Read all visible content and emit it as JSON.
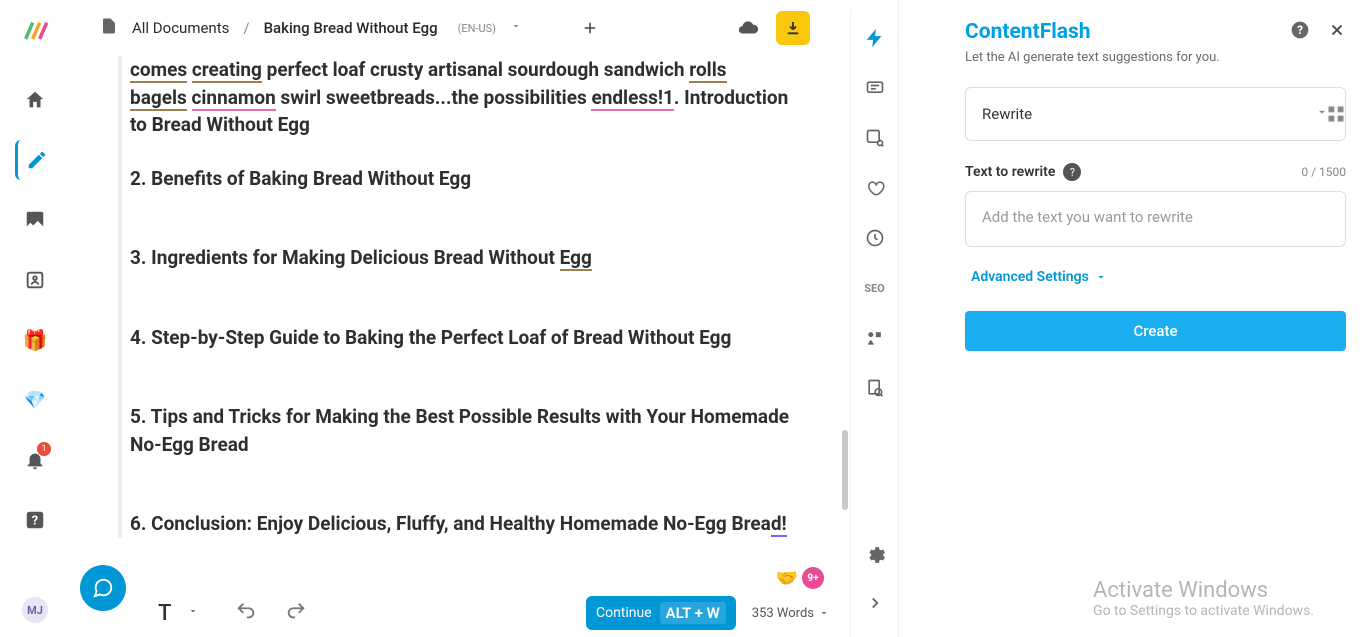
{
  "breadcrumb": {
    "root": "All Documents",
    "sep": "/",
    "title": "Baking Bread Without Egg",
    "lang": "(EN-US)"
  },
  "doc": {
    "line0_a": "comes",
    "line0_b": "creating",
    "line0_c": " perfect loaf crusty artisanal sourdough sandwich ",
    "line0_d": "rolls",
    "line1_a": "bagels",
    "line1_b": "cinnamon",
    "line1_c": " swirl sweetbreads...the possibilities ",
    "line1_d": "endless!1",
    "line1_e": ". Introduction to Bread Without Egg",
    "h2": "2. Benefits of Baking Bread Without Egg",
    "h3_a": "3. Ingredients for Making Delicious Bread Without ",
    "h3_b": "Egg",
    "h4": "4. Step-by-Step Guide to Baking the Perfect Loaf of Bread Without Egg",
    "h5": "5. Tips and Tricks for Making the Best Possible Results with Your Homemade No-Egg Bread",
    "h6_a": "6. Conclusion: Enjoy Delicious, Fluffy, and Healthy Homemade No-Egg Brea",
    "h6_b": "d!"
  },
  "bottom": {
    "continue": "Continue",
    "shortcut": "ALT + W",
    "wordcount": "353 Words",
    "badge": "9+"
  },
  "rail": {
    "avatar": "MJ",
    "notif": "1",
    "seo": "SEO"
  },
  "panel": {
    "title": "ContentFlash",
    "subtitle": "Let the AI generate text suggestions for you.",
    "select_value": "Rewrite",
    "field_label": "Text to rewrite",
    "counter": "0 / 1500",
    "placeholder": "Add the text you want to rewrite",
    "advanced": "Advanced Settings",
    "create": "Create"
  },
  "watermark": {
    "title": "Activate Windows",
    "sub": "Go to Settings to activate Windows."
  }
}
